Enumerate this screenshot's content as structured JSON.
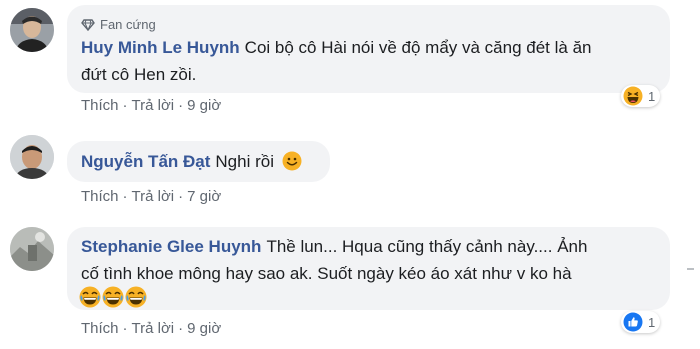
{
  "comments": [
    {
      "badge": "Fan cứng",
      "author": "Huy Minh Le Huynh",
      "text_line1": "Coi bộ cô Hài nói về độ mẩy và căng đét là ăn",
      "text_line2": "đứt cô Hen zồi.",
      "actions": {
        "like": "Thích",
        "reply": "Trả lời",
        "sep": "·",
        "time": "9 giờ"
      },
      "reaction": {
        "icon": "haha-emoji-icon",
        "count": "1"
      }
    },
    {
      "author": "Nguyễn Tấn Đạt",
      "text": "Nghi rồi",
      "inline_icon": "smile-emoji-icon",
      "actions": {
        "like": "Thích",
        "reply": "Trả lời",
        "sep": "·",
        "time": "7 giờ"
      }
    },
    {
      "author": "Stephanie Glee Huynh",
      "text_line1": "Thề lun... Hqua cũng thấy cảnh này.... Ảnh",
      "text_line2": "cố tình khoe mông hay sao ak. Suốt ngày kéo áo xát như v ko hà",
      "trailing_icons": [
        "laughing-emoji-icon",
        "laughing-emoji-icon",
        "laughing-emoji-icon"
      ],
      "actions": {
        "like": "Thích",
        "reply": "Trả lời",
        "sep": "·",
        "time": "9 giờ"
      },
      "reaction": {
        "icon": "like-icon",
        "count": "1"
      }
    }
  ],
  "colors": {
    "author": "#385898",
    "bubble": "#f2f3f5",
    "meta": "#606770",
    "like": "#1877f2",
    "emoji": "#f7b125"
  }
}
